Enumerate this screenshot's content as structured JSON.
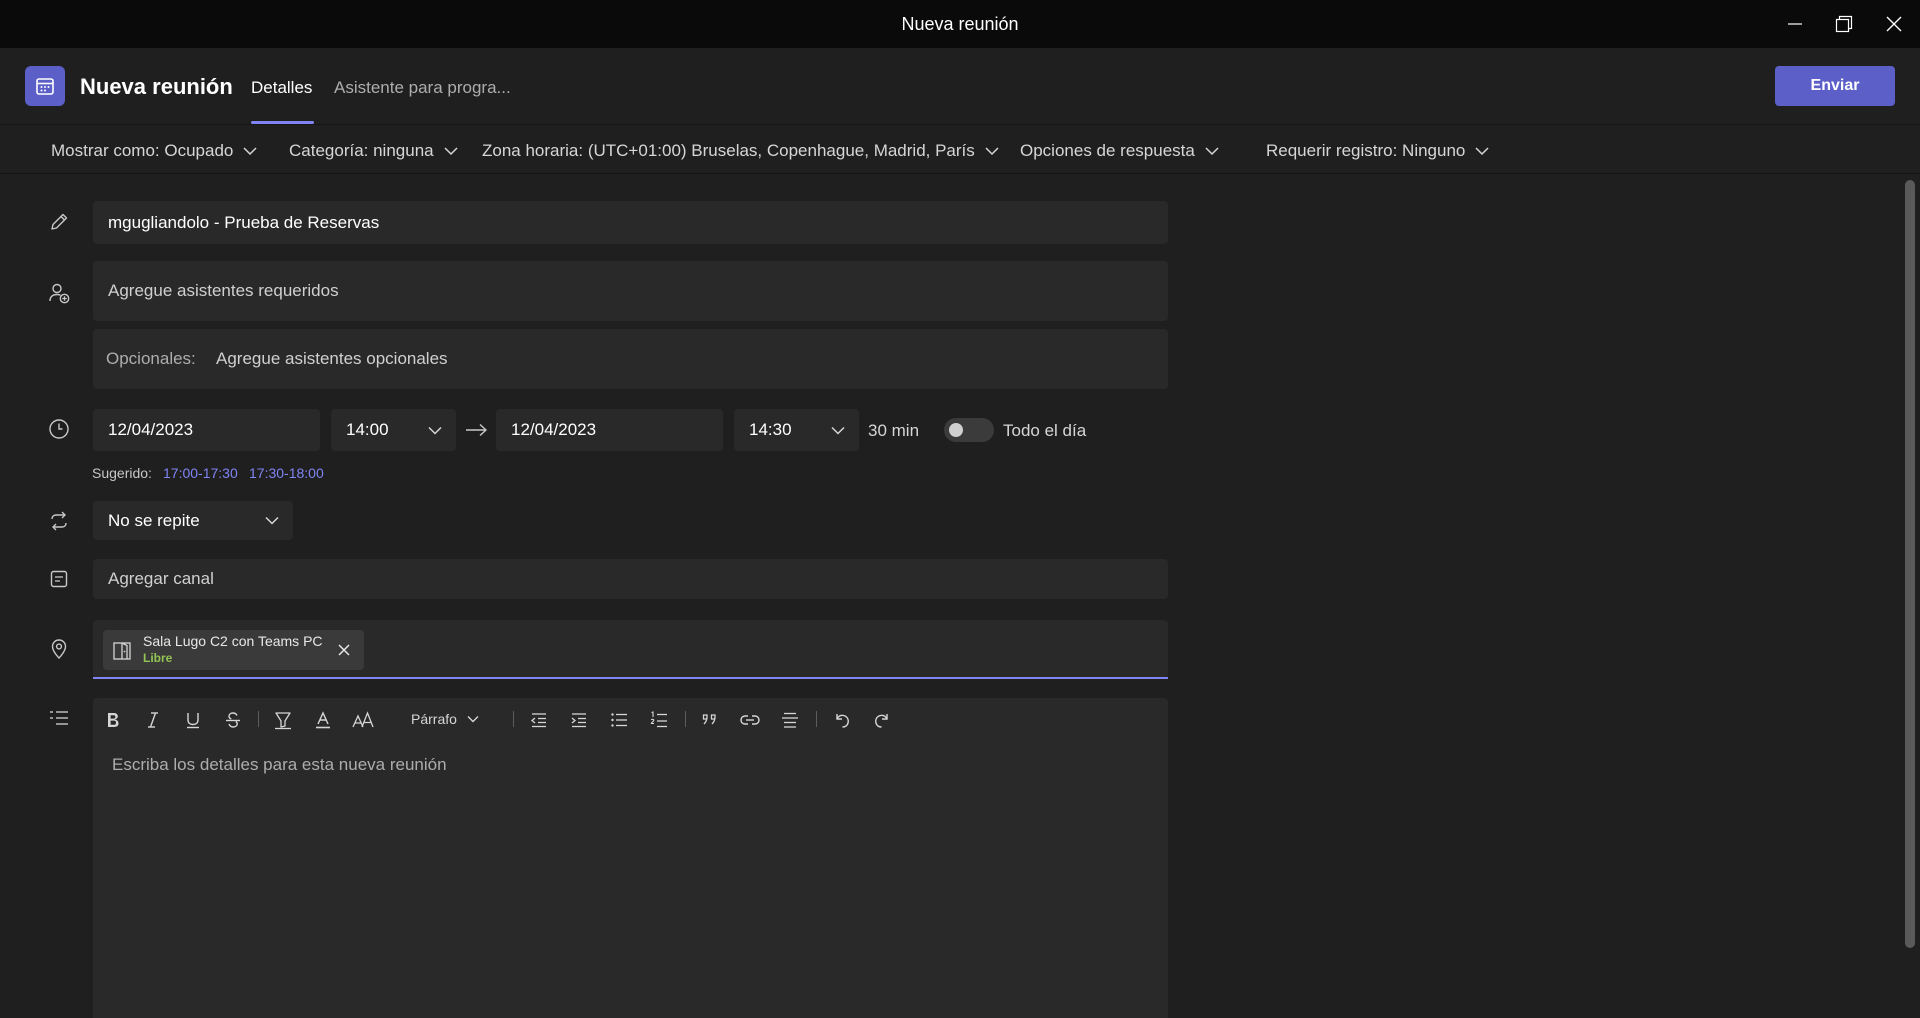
{
  "window": {
    "title": "Nueva reunión"
  },
  "header": {
    "title": "Nueva reunión",
    "tabs": [
      {
        "label": "Detalles",
        "active": true
      },
      {
        "label": "Asistente para progra..."
      }
    ],
    "send_label": "Enviar"
  },
  "options": {
    "show_as": "Mostrar como: Ocupado",
    "category": "Categoría: ninguna",
    "timezone": "Zona horaria: (UTC+01:00) Bruselas, Copenhague, Madrid, París",
    "response_options": "Opciones de respuesta",
    "registration": "Requerir registro: Ninguno"
  },
  "form": {
    "title_value": "mgugliandolo - Prueba de Reservas",
    "required_placeholder": "Agregue asistentes requeridos",
    "optional_label": "Opcionales:",
    "optional_placeholder": "Agregue asistentes opcionales",
    "start_date": "12/04/2023",
    "start_time": "14:00",
    "end_date": "12/04/2023",
    "end_time": "14:30",
    "duration": "30 min",
    "all_day_label": "Todo el día",
    "all_day": false,
    "suggested_label": "Sugerido:",
    "suggestions": [
      "17:00-17:30",
      "17:30-18:00"
    ],
    "repeat": "No se repite",
    "channel_placeholder": "Agregar canal",
    "room": {
      "name": "Sala Lugo C2 con Teams PC",
      "status": "Libre"
    },
    "details_placeholder": "Escriba los detalles para esta nueva reunión"
  },
  "editor_toolbar": {
    "paragraph_label": "Párrafo"
  },
  "colors": {
    "accent": "#5b5fc7",
    "accent_light": "#7f85f5",
    "link": "#7f85f5",
    "available": "#92c353",
    "background": "#1f1f1f",
    "field": "#292929"
  }
}
